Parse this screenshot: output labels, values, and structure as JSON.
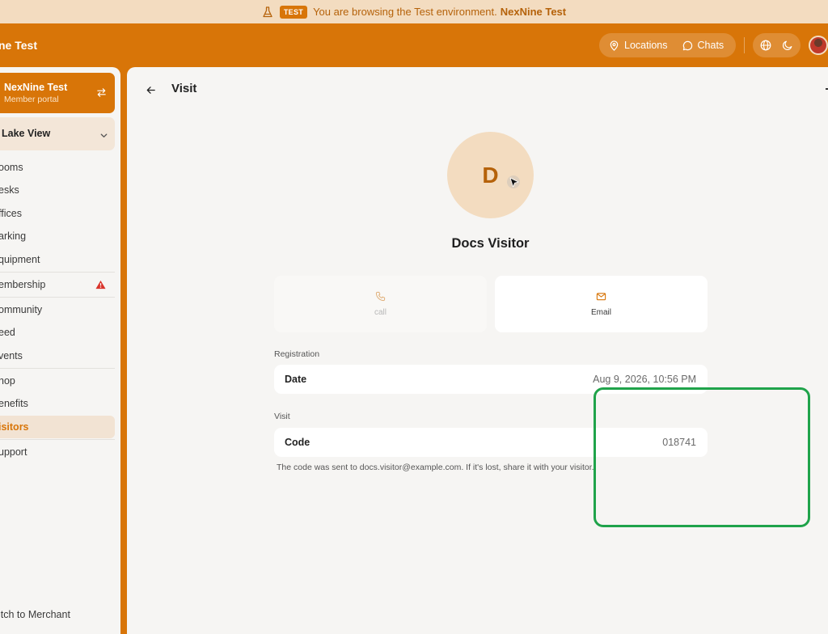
{
  "banner": {
    "badge": "TEST",
    "message": "You are browsing the Test environment.",
    "org": "NexNine Test"
  },
  "header": {
    "app_title": "ne Test",
    "nav": [
      {
        "label": "Locations",
        "icon": "map-pin-icon"
      },
      {
        "label": "Chats",
        "icon": "chat-bubble-icon"
      }
    ],
    "tools": [
      {
        "icon": "globe-icon"
      },
      {
        "icon": "moon-icon"
      }
    ]
  },
  "sidebar": {
    "org_name": "NexNine Test",
    "org_sub": "Member portal",
    "location": "Lake View",
    "items": [
      {
        "label": "ooms"
      },
      {
        "label": "esks"
      },
      {
        "label": "ffices"
      },
      {
        "label": "arking"
      },
      {
        "label": "quipment"
      },
      {
        "label": "embership",
        "warning": true
      },
      {
        "label": "ommunity"
      },
      {
        "label": "eed"
      },
      {
        "label": "vents"
      },
      {
        "label": "hop"
      },
      {
        "label": "enefits"
      },
      {
        "label": "isitors",
        "active": true
      },
      {
        "label": "upport"
      }
    ],
    "footer": "itch to Merchant"
  },
  "main": {
    "title": "Visit",
    "avatar_initial": "D",
    "visitor_name": "Docs Visitor",
    "actions": {
      "call": "call",
      "email": "Email"
    },
    "registration": {
      "section": "Registration",
      "key": "Date",
      "value": "Aug 9, 2026, 10:56 PM"
    },
    "visit": {
      "section": "Visit",
      "key": "Code",
      "value": "018741",
      "hint": "The code was sent to docs.visitor@example.com. If it's lost, share it with your visitor."
    }
  },
  "colors": {
    "brand": "#d87508",
    "highlight": "#1fa34a",
    "warning": "#d9342b"
  }
}
